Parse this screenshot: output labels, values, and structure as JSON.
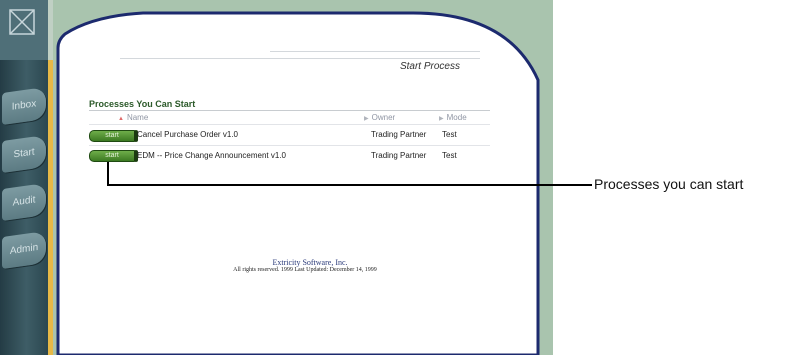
{
  "sidebar": {
    "logo_icon": "x-box-icon",
    "tabs": [
      {
        "label": "Inbox"
      },
      {
        "label": "Start"
      },
      {
        "label": "Audit"
      },
      {
        "label": "Admin"
      }
    ]
  },
  "header": {
    "title": "Start Process"
  },
  "section": {
    "title": "Processes You Can Start",
    "columns": {
      "name": "Name",
      "owner": "Owner",
      "mode": "Mode"
    },
    "rows": [
      {
        "button": "start",
        "name": "Cancel Purchase Order v1.0",
        "owner": "Trading Partner",
        "mode": "Test"
      },
      {
        "button": "start",
        "name": "EDM -- Price Change Announcement v1.0",
        "owner": "Trading Partner",
        "mode": "Test"
      }
    ]
  },
  "footer": {
    "company": "Extricity Software, Inc.",
    "rights": "All rights reserved. 1999 Last Updated: December 14, 1999"
  },
  "callout": {
    "label": "Processes you can start"
  },
  "colors": {
    "sidebar": "#3e5d66",
    "accent_gold": "#e7b947",
    "background_green": "#a9c4ae",
    "panel_border": "#1c2a6e",
    "start_button": "#4a8a2e"
  }
}
